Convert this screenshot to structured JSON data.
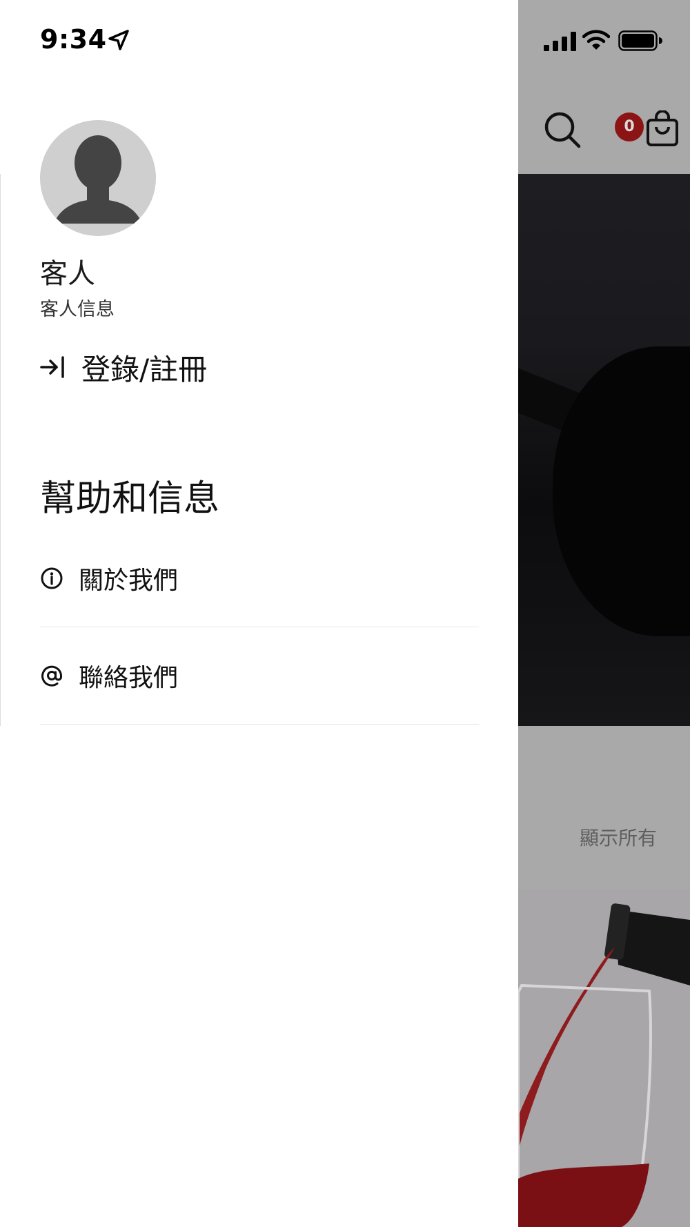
{
  "status_bar": {
    "time": "9:34"
  },
  "drawer": {
    "user": {
      "name": "客人",
      "subtitle": "客人信息"
    },
    "login_label": "登錄/註冊",
    "help_section": {
      "heading": "幫助和信息",
      "items": [
        {
          "label": "關於我們",
          "icon": "info-icon"
        },
        {
          "label": "聯絡我們",
          "icon": "at-icon"
        }
      ]
    }
  },
  "background_app": {
    "cart_count": "0",
    "show_all_label": "顯示所有",
    "colors": {
      "badge": "#8c1414",
      "overlay": "#7a7a7a"
    }
  }
}
